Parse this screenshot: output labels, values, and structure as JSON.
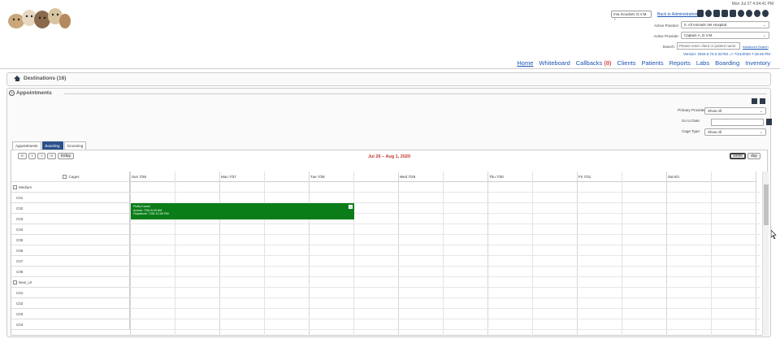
{
  "header": {
    "timestamp": "Mon Jul 27 4:04:41 PM",
    "user_select": "Ima Goodvet, D.V.M.",
    "back_to_admin": "Back to Administration",
    "active_practice_label": "Active Practice:",
    "active_practice_value": "0. All Animals Vet Hospital",
    "active_provider_label": "Active Provider:",
    "active_provider_value": "Captain A, D.V.M.",
    "search_label": "Search:",
    "search_placeholder": "Please enter client or patient name",
    "advanced_search": "Advanced Search",
    "version": "Version: 2020.6.70.0.34793 => 7/24/2020 7:18:46 PM",
    "icons": [
      "lock-icon",
      "clock-icon",
      "pills-icon",
      "clipboard-icon",
      "mail-icon",
      "gear-icon",
      "chat-icon",
      "help-icon",
      "power-icon"
    ]
  },
  "nav": {
    "items": [
      {
        "label": "Home",
        "active": true
      },
      {
        "label": "Whiteboard"
      },
      {
        "label": "Callbacks",
        "count": "(8)"
      },
      {
        "label": "Clients"
      },
      {
        "label": "Patients"
      },
      {
        "label": "Reports"
      },
      {
        "label": "Labs"
      },
      {
        "label": "Boarding"
      },
      {
        "label": "Inventory"
      }
    ]
  },
  "destinations": {
    "title": "Destinations (16)"
  },
  "appointments": {
    "title": "Appointments",
    "primary_provider_label": "Primary Provider:",
    "primary_provider_value": "Show All",
    "go_to_date_label": "Go to Date:",
    "cage_type_label": "Cage Type:",
    "cage_type_value": "Show All",
    "tabs": [
      {
        "label": "Appointments"
      },
      {
        "label": "Boarding",
        "active": true
      },
      {
        "label": "Grooming"
      }
    ]
  },
  "calendar": {
    "nav_buttons": [
      "«",
      "‹",
      "›",
      "»",
      "today"
    ],
    "range_title": "Jul 26 – Aug 1, 2020",
    "view_buttons": [
      {
        "label": "week",
        "active": true
      },
      {
        "label": "day"
      }
    ],
    "resource_header": "Cages",
    "days": [
      "Sun 7/26",
      "Mon 7/27",
      "Tue 7/28",
      "Wed 7/29",
      "Thu 7/30",
      "Fri 7/31",
      "Sat 8/1"
    ],
    "rows": [
      {
        "label": "Medium",
        "group": true
      },
      {
        "label": "C01"
      },
      {
        "label": "C02"
      },
      {
        "label": "C03"
      },
      {
        "label": "C04"
      },
      {
        "label": "C05"
      },
      {
        "label": "C06"
      },
      {
        "label": "C07"
      },
      {
        "label": "C08"
      },
      {
        "label": "New_UI",
        "group": true
      },
      {
        "label": "C01"
      },
      {
        "label": "C02"
      },
      {
        "label": "C03"
      },
      {
        "label": "C04"
      }
    ],
    "event": {
      "line1": "Fluffy Kowal",
      "line2": "Arrival: 7/26 5:00 AM",
      "line3": "Departure: 7/28 12:00 PM",
      "color": "#0a7d18"
    }
  }
}
